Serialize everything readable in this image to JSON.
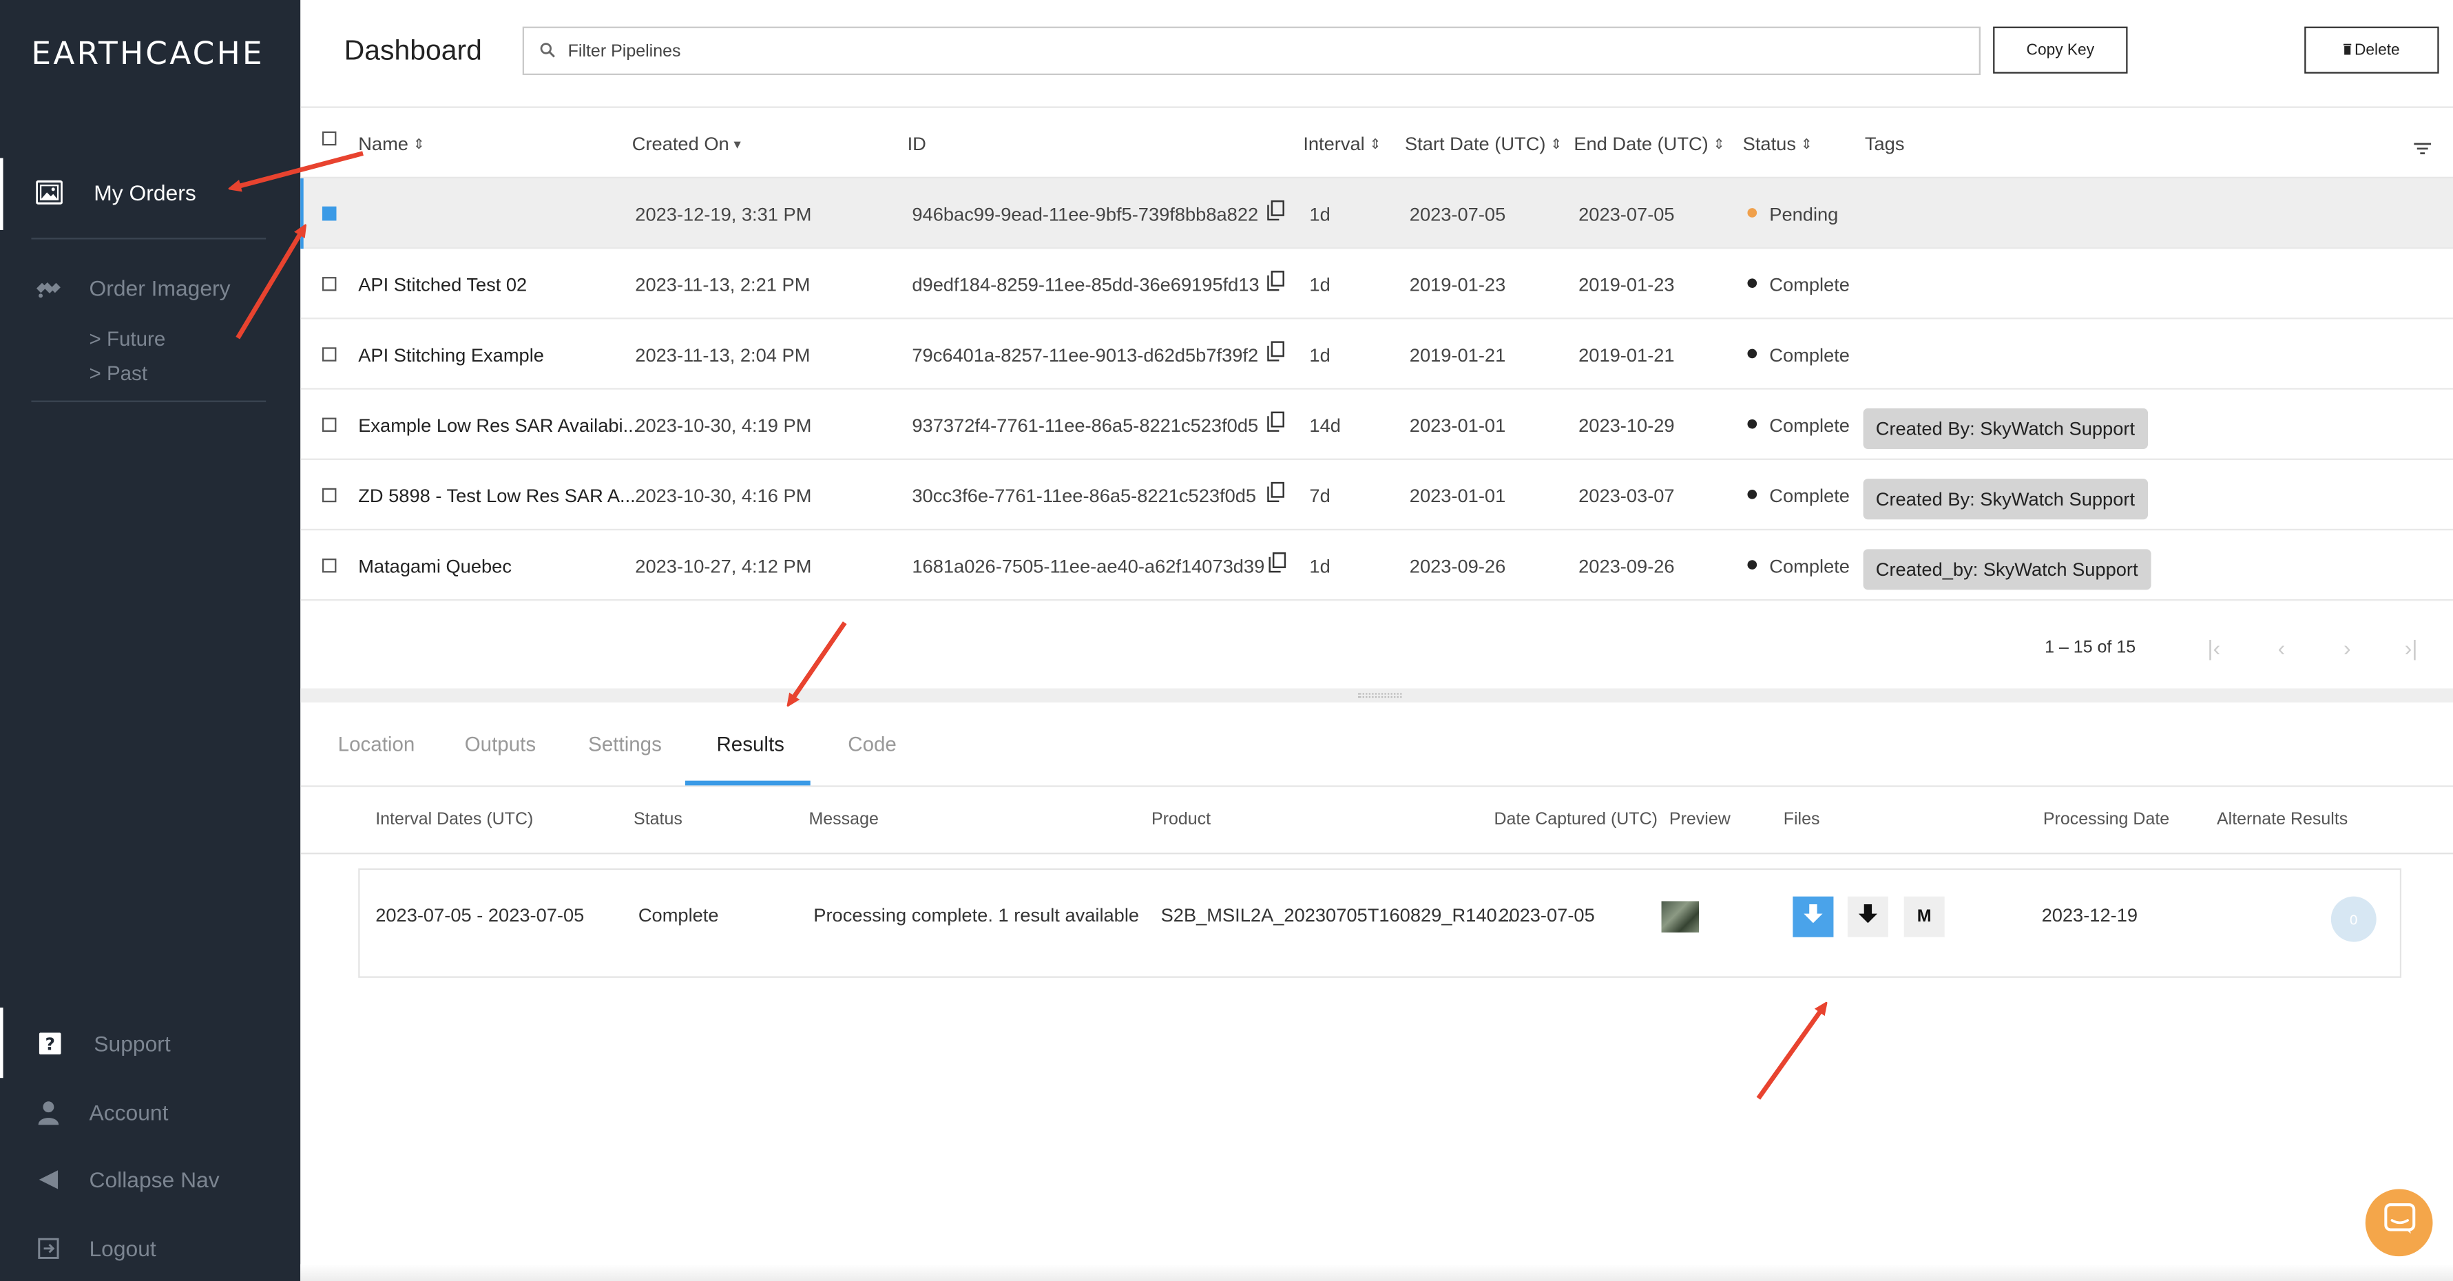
{
  "app": {
    "logo": "EARTHCACHE"
  },
  "sidebar": {
    "items": [
      {
        "label": "My Orders",
        "icon": "image-icon"
      },
      {
        "label": "Order Imagery",
        "icon": "satellite-icon"
      }
    ],
    "sub_items": [
      "> Future",
      "> Past"
    ],
    "bottom_items": [
      {
        "label": "Support",
        "icon": "question-icon"
      },
      {
        "label": "Account",
        "icon": "user-icon"
      },
      {
        "label": "Collapse Nav",
        "icon": "triangle-left-icon"
      },
      {
        "label": "Logout",
        "icon": "logout-icon"
      }
    ]
  },
  "header": {
    "title": "Dashboard",
    "filter_placeholder": "Filter Pipelines",
    "copy_key": "Copy Key",
    "delete": "Delete"
  },
  "table": {
    "columns": [
      "Name",
      "Created On",
      "ID",
      "Interval",
      "Start Date (UTC)",
      "End Date (UTC)",
      "Status",
      "Tags"
    ],
    "rows": [
      {
        "name": "",
        "created": "2023-12-19, 3:31 PM",
        "id": "946bac99-9ead-11ee-9bf5-739f8bb8a822",
        "interval": "1d",
        "start": "2023-07-05",
        "end": "2023-07-05",
        "status": "Pending",
        "tag": ""
      },
      {
        "name": "API Stitched Test 02",
        "created": "2023-11-13, 2:21 PM",
        "id": "d9edf184-8259-11ee-85dd-36e69195fd13",
        "interval": "1d",
        "start": "2019-01-23",
        "end": "2019-01-23",
        "status": "Complete",
        "tag": ""
      },
      {
        "name": "API Stitching Example",
        "created": "2023-11-13, 2:04 PM",
        "id": "79c6401a-8257-11ee-9013-d62d5b7f39f2",
        "interval": "1d",
        "start": "2019-01-21",
        "end": "2019-01-21",
        "status": "Complete",
        "tag": ""
      },
      {
        "name": "Example Low Res SAR Availabi...",
        "created": "2023-10-30, 4:19 PM",
        "id": "937372f4-7761-11ee-86a5-8221c523f0d5",
        "interval": "14d",
        "start": "2023-01-01",
        "end": "2023-10-29",
        "status": "Complete",
        "tag": "Created By: SkyWatch Support"
      },
      {
        "name": "ZD 5898 - Test Low Res SAR A...",
        "created": "2023-10-30, 4:16 PM",
        "id": "30cc3f6e-7761-11ee-86a5-8221c523f0d5",
        "interval": "7d",
        "start": "2023-01-01",
        "end": "2023-03-07",
        "status": "Complete",
        "tag": "Created By: SkyWatch Support"
      },
      {
        "name": "Matagami Quebec",
        "created": "2023-10-27, 4:12 PM",
        "id": "1681a026-7505-11ee-ae40-a62f14073d39",
        "interval": "1d",
        "start": "2023-09-26",
        "end": "2023-09-26",
        "status": "Complete",
        "tag": "Created_by: SkyWatch Support"
      }
    ],
    "pagination": "1 – 15 of 15"
  },
  "tabs": [
    "Location",
    "Outputs",
    "Settings",
    "Results",
    "Code"
  ],
  "active_tab": "Results",
  "results": {
    "columns": [
      "Interval Dates (UTC)",
      "Status",
      "Message",
      "Product",
      "Date Captured (UTC)",
      "Preview",
      "Files",
      "Processing Date",
      "Alternate Results"
    ],
    "row": {
      "interval": "2023-07-05 - 2023-07-05",
      "status": "Complete",
      "message": "Processing complete. 1 result available",
      "product": "S2B_MSIL2A_20230705T160829_R140...",
      "captured": "2023-07-05",
      "processing": "2023-12-19",
      "alt_count": "0",
      "file_m": "M"
    }
  },
  "colors": {
    "sidebar": "#222a35",
    "accent": "#3a9ae6",
    "pending": "#f0a04b",
    "complete": "#222222",
    "annotation": "#e8432f",
    "chat": "#f4a64a"
  }
}
